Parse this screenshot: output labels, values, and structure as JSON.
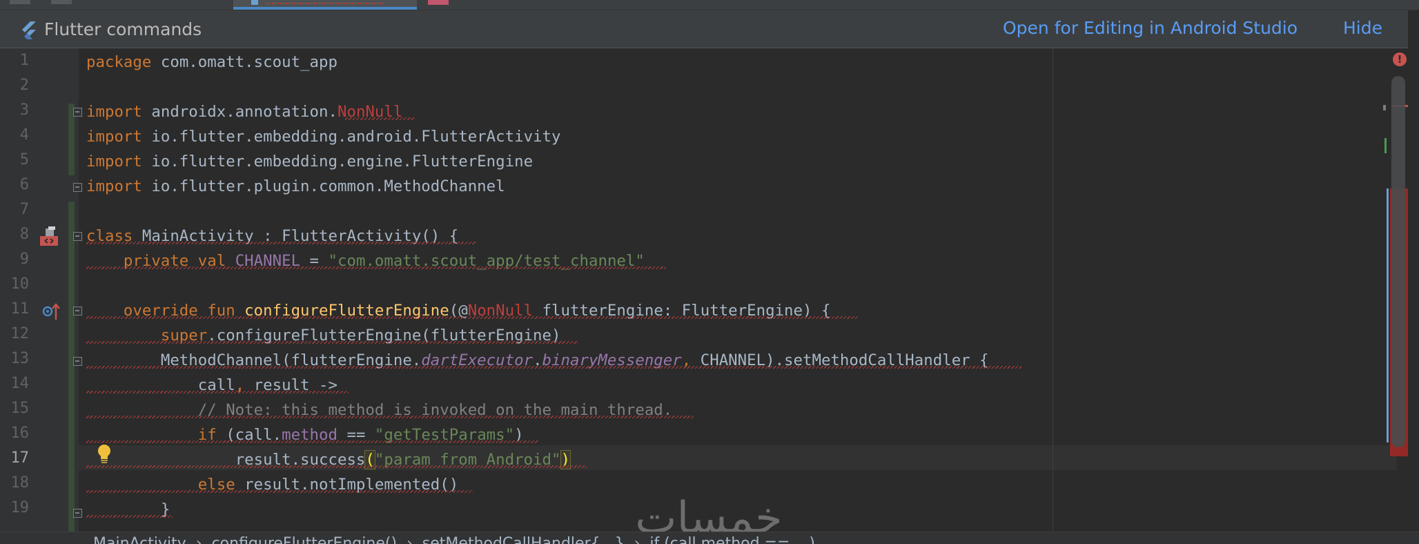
{
  "banner": {
    "title": "Flutter commands",
    "open_link": "Open for Editing in Android Studio",
    "hide_link": "Hide"
  },
  "editor": {
    "current_line": 17,
    "error_indicator": "!",
    "lines": [
      {
        "n": "1"
      },
      {
        "n": "2"
      },
      {
        "n": "3"
      },
      {
        "n": "4"
      },
      {
        "n": "5"
      },
      {
        "n": "6"
      },
      {
        "n": "7"
      },
      {
        "n": "8"
      },
      {
        "n": "9"
      },
      {
        "n": "10"
      },
      {
        "n": "11"
      },
      {
        "n": "12"
      },
      {
        "n": "13"
      },
      {
        "n": "14"
      },
      {
        "n": "15"
      },
      {
        "n": "16"
      },
      {
        "n": "17"
      },
      {
        "n": "18"
      },
      {
        "n": "19"
      }
    ],
    "code": {
      "l1": {
        "kw": "package",
        "rest": " com.omatt.scout_app"
      },
      "l3": {
        "kw": "import",
        "pkg": " androidx.annotation.",
        "ann": "NonNull"
      },
      "l4": {
        "kw": "import",
        "rest": " io.flutter.embedding.android.FlutterActivity"
      },
      "l5": {
        "kw": "import",
        "rest": " io.flutter.embedding.engine.FlutterEngine"
      },
      "l6": {
        "kw": "import",
        "rest": " io.flutter.plugin.common.MethodChannel"
      },
      "l8": {
        "kw": "class",
        "rest": " MainActivity : FlutterActivity() {"
      },
      "l9": {
        "indent": "    ",
        "kw": "private val",
        "sp": " ",
        "fld": "CHANNEL",
        "eq": " = ",
        "str": "\"com.omatt.scout_app/test_channel\""
      },
      "l11": {
        "indent": "    ",
        "kw": "override fun",
        "sp": " ",
        "fn": "configureFlutterEngine",
        "p1": "(@",
        "ann": "NonNull",
        "p2": " flutterEngine: FlutterEngine) {"
      },
      "l12": {
        "indent": "        ",
        "kw": "super",
        "rest": ".configureFlutterEngine(flutterEngine)"
      },
      "l13": {
        "indent": "        ",
        "p1": "MethodChannel(flutterEngine.",
        "i1": "dartExecutor",
        "dot": ".",
        "i2": "binaryMessenger",
        "comma": ",",
        "p2": " CHANNEL).setMethodCallHandler {"
      },
      "l14": {
        "indent": "            ",
        "p1": "call",
        "comma": ",",
        "p2": " result ->"
      },
      "l15": {
        "indent": "            ",
        "cmt": "// Note: this method is invoked on the main thread."
      },
      "l16": {
        "indent": "            ",
        "kw": "if",
        "p1": " (call.",
        "fld": "method",
        "p2": " == ",
        "str": "\"getTestParams\"",
        "p3": ")"
      },
      "l17": {
        "indent": "                ",
        "p1": "result.success",
        "open": "(",
        "str": "\"param from Android\"",
        "close": ")"
      },
      "l18": {
        "indent": "            ",
        "kw": "else",
        "rest": " result.notImplemented()"
      },
      "l19": {
        "indent": "        ",
        "rest": "}"
      }
    }
  },
  "breadcrumb": {
    "text": "MainActivity  ›  configureFlutterEngine()  ›  setMethodCallHandler{...}  ›  if (call.method == ...)"
  },
  "watermark": {
    "text": "خمسات"
  },
  "colors": {
    "background": "#2B2B2B",
    "gutter": "#313335",
    "keyword": "#CC7832",
    "string": "#6A8759",
    "function": "#FFC66D",
    "field": "#9876AA",
    "annotation": "#BC3F3C",
    "comment": "#808080",
    "link": "#589DF6",
    "error": "#C75450"
  },
  "icons": [
    "flutter-icon",
    "class-run-icon",
    "override-icon",
    "lightbulb-icon",
    "error-icon"
  ]
}
